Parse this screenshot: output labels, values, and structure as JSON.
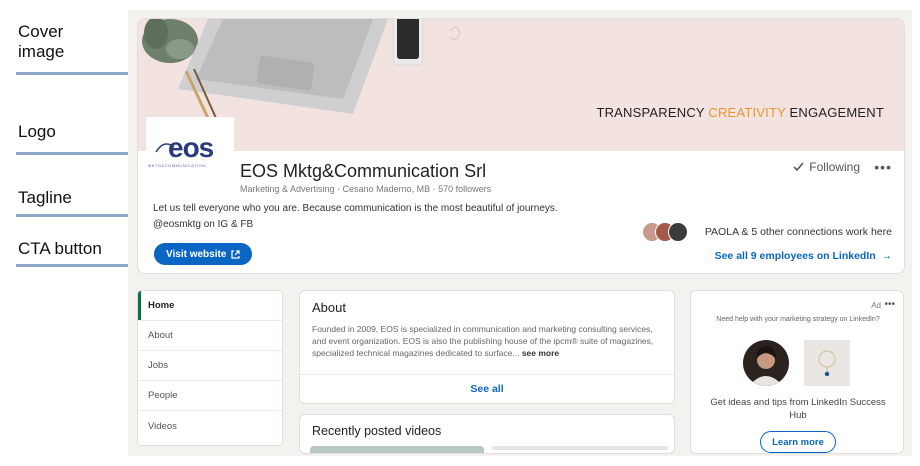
{
  "annotations": {
    "cover_image": "Cover\nimage",
    "logo": "Logo",
    "tagline": "Tagline",
    "cta_button": "CTA button"
  },
  "cover": {
    "slogan_part1": "TRANSPARENCY ",
    "slogan_accent": "CREATIVITY",
    "slogan_part2": " ENGAGEMENT"
  },
  "logo": {
    "text": "eos",
    "subtext": "MKTG&COMMUNICATION"
  },
  "company": {
    "name": "EOS Mktg&Communication Srl",
    "meta": "Marketing & Advertising · Cesano Maderno, MB · 570 followers",
    "tagline": "Let us tell everyone who you are. Because communication is the most beautiful of journeys. @eosmktg on IG & FB",
    "cta_label": "Visit website",
    "following_label": "Following",
    "more_label": "•••",
    "connections_text": "PAOLA & 5 other connections work here",
    "employees_link": "See all 9 employees on LinkedIn"
  },
  "nav": {
    "items": [
      {
        "label": "Home"
      },
      {
        "label": "About"
      },
      {
        "label": "Jobs"
      },
      {
        "label": "People"
      },
      {
        "label": "Videos"
      }
    ]
  },
  "about": {
    "title": "About",
    "body": "Founded in 2009, EOS is specialized in communication and marketing consulting services, and event organization. EOS is also the publishing house of the ipcm® suite of magazines, specialized technical magazines dedicated to surface...",
    "more": "see more",
    "see_all": "See all"
  },
  "videos": {
    "title": "Recently posted videos"
  },
  "ad": {
    "label": "Ad",
    "dots": "•••",
    "help": "Need help with your marketing strategy on LinkedIn?",
    "copy": "Get ideas and tips from LinkedIn Success Hub",
    "learn_more": "Learn more"
  },
  "colors": {
    "linkedin_blue": "#0a66c2",
    "nav_active": "#057642",
    "cover_bg": "#f3e3e0",
    "accent_orange": "#e8962c",
    "logo_navy": "#2b3a78"
  }
}
